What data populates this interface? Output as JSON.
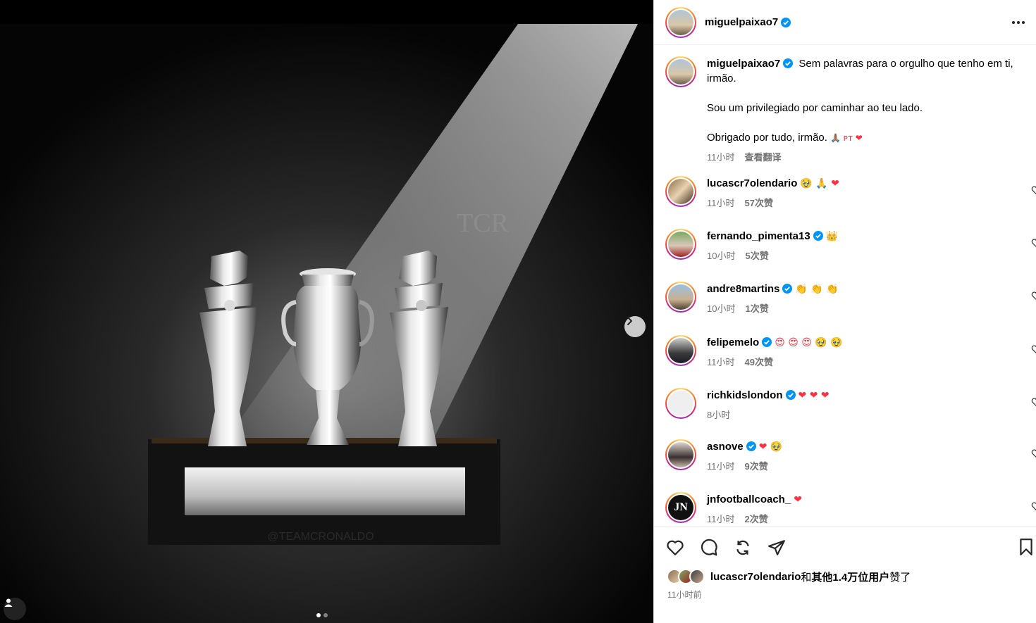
{
  "post": {
    "author": "miguelpaixao7",
    "more_label": "更多选项"
  },
  "caption": {
    "username": "miguelpaixao7",
    "line1": "Sem palavras para o orgulho que tenho em ti, irmão.",
    "line2": "Sou um privilegiado por caminhar ao teu lado.",
    "line3": "Obrigado por tudo, irmão.",
    "line3_emoji": "🙏🏽 ᴘᴛ ❤",
    "time": "11小时",
    "translate": "查看翻译"
  },
  "comments": [
    {
      "username": "lucascr7olendario",
      "verified": false,
      "text": "🥹 🙏 ❤",
      "time": "11小时",
      "likes": "57次赞"
    },
    {
      "username": "fernando_pimenta13",
      "verified": true,
      "text": "👑",
      "time": "10小时",
      "likes": "5次赞"
    },
    {
      "username": "andre8martins",
      "verified": true,
      "text": "👏 👏 👏",
      "time": "10小时",
      "likes": "1次赞"
    },
    {
      "username": "felipemelo",
      "verified": true,
      "text": "😍 😍 😍 🥹 🥹",
      "time": "11小时",
      "likes": "49次赞"
    },
    {
      "username": "richkidslondon",
      "verified": true,
      "text": "❤ ❤ ❤",
      "time": "8小时",
      "likes": ""
    },
    {
      "username": "asnove",
      "verified": true,
      "text": "❤ 🥹",
      "time": "11小时",
      "likes": "9次赞"
    },
    {
      "username": "jnfootballcoach_",
      "verified": false,
      "text": "❤",
      "time": "11小时",
      "likes": "2次赞"
    }
  ],
  "likes": {
    "first_user": "lucascr7olendario",
    "rest": "和",
    "others": "其他1.4万位用户",
    "suffix": "赞了"
  },
  "timestamp": "11小时前",
  "image": {
    "watermark_top": "TCR",
    "watermark_bottom": "@TEAMCRONALDO",
    "carousel_index": 1,
    "carousel_total": 2
  },
  "colors": {
    "verified": "#0095f6",
    "heart": "#ff3040",
    "meta": "#737373"
  }
}
